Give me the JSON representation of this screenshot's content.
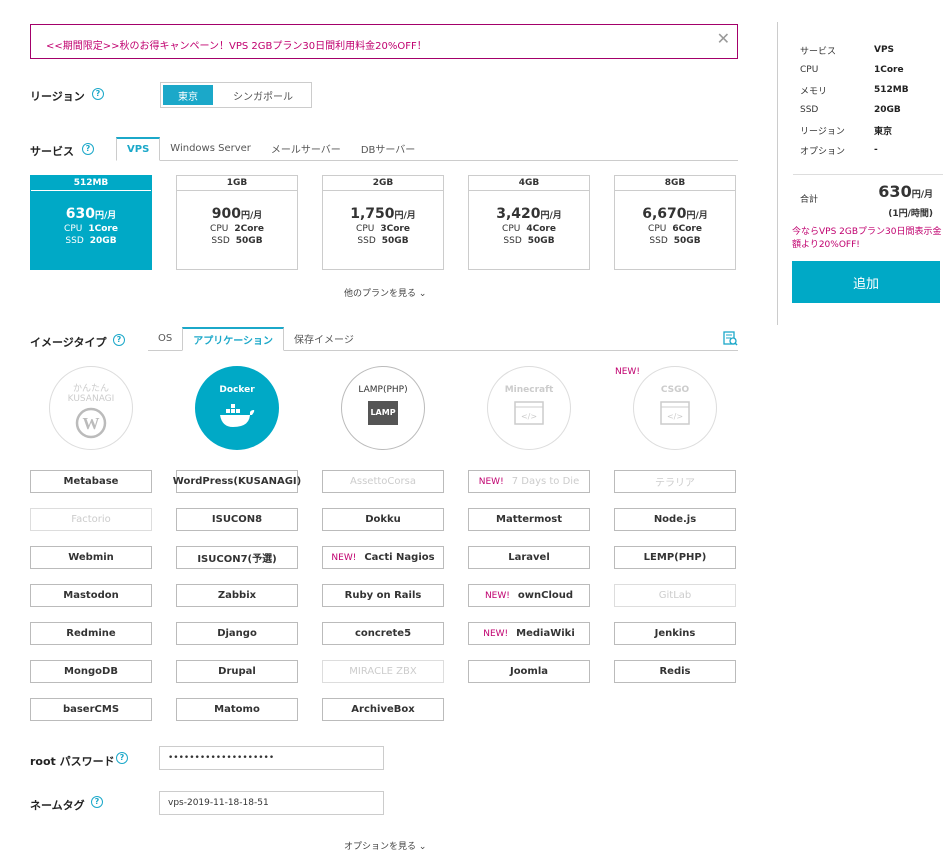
{
  "banner": {
    "text": "<<期間限定>>秋のお得キャンペーン！VPS 2GBプラン30日間利用料金20%OFF！",
    "close": "✕"
  },
  "region": {
    "label": "リージョン",
    "help": "?",
    "options": [
      "東京",
      "シンガポール"
    ],
    "selected": "東京"
  },
  "service": {
    "label": "サービス",
    "help": "?",
    "tabs": [
      "VPS",
      "Windows Server",
      "メールサーバー",
      "DBサーバー"
    ],
    "selected": "VPS"
  },
  "plans": [
    {
      "name": "512MB",
      "price": "630",
      "unit": "円/月",
      "cpu_label": "CPU",
      "cpu": "1Core",
      "ssd_label": "SSD",
      "ssd": "20GB"
    },
    {
      "name": "1GB",
      "price": "900",
      "unit": "円/月",
      "cpu_label": "CPU",
      "cpu": "2Core",
      "ssd_label": "SSD",
      "ssd": "50GB"
    },
    {
      "name": "2GB",
      "price": "1,750",
      "unit": "円/月",
      "cpu_label": "CPU",
      "cpu": "3Core",
      "ssd_label": "SSD",
      "ssd": "50GB"
    },
    {
      "name": "4GB",
      "price": "3,420",
      "unit": "円/月",
      "cpu_label": "CPU",
      "cpu": "4Core",
      "ssd_label": "SSD",
      "ssd": "50GB"
    },
    {
      "name": "8GB",
      "price": "6,670",
      "unit": "円/月",
      "cpu_label": "CPU",
      "cpu": "6Core",
      "ssd_label": "SSD",
      "ssd": "50GB"
    }
  ],
  "more_plans": "他のプランを見る",
  "image_type": {
    "label": "イメージタイプ",
    "help": "?",
    "tabs": [
      "OS",
      "アプリケーション",
      "保存イメージ"
    ],
    "selected": "アプリケーション"
  },
  "featured": [
    {
      "title": "かんたん KUSANAGI"
    },
    {
      "title": "Docker"
    },
    {
      "title": "LAMP(PHP)",
      "badge": "LAMP"
    },
    {
      "title": "Minecraft"
    },
    {
      "title": "CSGO",
      "new": "NEW!"
    }
  ],
  "apps": [
    [
      "Metabase",
      "WordPress(KUSANAGI)",
      "AssettoCorsa",
      "7 Days to Die",
      "テラリア"
    ],
    [
      "Factorio",
      "ISUCON8",
      "Dokku",
      "Mattermost",
      "Node.js"
    ],
    [
      "Webmin",
      "ISUCON7(予選)",
      "Cacti Nagios",
      "Laravel",
      "LEMP(PHP)"
    ],
    [
      "Mastodon",
      "Zabbix",
      "Ruby on Rails",
      "ownCloud",
      "GitLab"
    ],
    [
      "Redmine",
      "Django",
      "concrete5",
      "MediaWiki",
      "Jenkins"
    ],
    [
      "MongoDB",
      "Drupal",
      "MIRACLE ZBX",
      "Joomla",
      "Redis"
    ],
    [
      "baserCMS",
      "Matomo",
      "ArchiveBox"
    ]
  ],
  "new_tag": "NEW!",
  "root_password": {
    "label": "root パスワード",
    "help": "?",
    "value": "••••••••••••••••••••"
  },
  "name_tag": {
    "label": "ネームタグ",
    "help": "?",
    "value": "vps-2019-11-18-18-51"
  },
  "more_options": "オプションを見る",
  "summary": {
    "rows": [
      [
        "サービス",
        "VPS"
      ],
      [
        "CPU",
        "1Core"
      ],
      [
        "メモリ",
        "512MB"
      ],
      [
        "SSD",
        "20GB"
      ],
      [
        "リージョン",
        "東京"
      ],
      [
        "オプション",
        "-"
      ]
    ],
    "total_label": "合計",
    "total": "630",
    "total_unit": "円/月",
    "hourly": "(1円/時間)",
    "promo": "今ならVPS 2GBプラン30日間表示金額より20%OFF!",
    "add": "追加"
  }
}
